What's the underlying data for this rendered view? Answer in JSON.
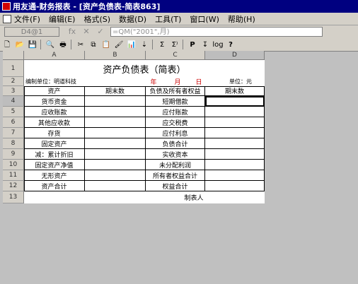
{
  "window": {
    "title": "用友通-财务报表 - [资产负债表-简表863]"
  },
  "menu": [
    "文件(F)",
    "编辑(E)",
    "格式(S)",
    "数据(D)",
    "工具(T)",
    "窗口(W)",
    "帮助(H)"
  ],
  "formula_bar": {
    "cell_ref": "D4@1",
    "fx": "fx",
    "cancel": "✕",
    "confirm": "✓",
    "formula": "=QM(\"2001\",月)"
  },
  "toolbar": {
    "new": "🗋",
    "open": "📂",
    "save": "💾",
    "preview": "🔍",
    "print": "🖶",
    "cut": "✂",
    "copy": "⧉",
    "paste": "📋",
    "format_painter": "🖌",
    "chart": "📊",
    "sort": "⇣",
    "sum": "Σ",
    "sum2": "Σ⁾",
    "p": "P",
    "insert": "↧",
    "log": "log",
    "help": "?"
  },
  "sheet": {
    "columns": [
      "A",
      "B",
      "C",
      "D"
    ],
    "rows": [
      "1",
      "2",
      "3",
      "4",
      "5",
      "6",
      "7",
      "8",
      "9",
      "10",
      "11",
      "12",
      "13"
    ],
    "title": "资产负债表（简表）",
    "unit_left": "编制单位：明道科技",
    "year": "年",
    "month": "月",
    "day": "日",
    "unit_right": "单位：元",
    "header": {
      "a": "资产",
      "b": "期末数",
      "c": "负债及所有者权益",
      "d": "期末数"
    },
    "assets": [
      "货币资金",
      "应收账款",
      "其他应收款",
      "存货",
      "固定资产",
      "减：累计折旧",
      "固定资产净值",
      "无形资产",
      "资产合计"
    ],
    "liabilities": [
      "短期借款",
      "应付账款",
      "应交税费",
      "应付利息",
      "负债合计",
      "实收资本",
      "未分配利润",
      "所有者权益合计",
      "权益合计"
    ],
    "footer": "制表人"
  }
}
